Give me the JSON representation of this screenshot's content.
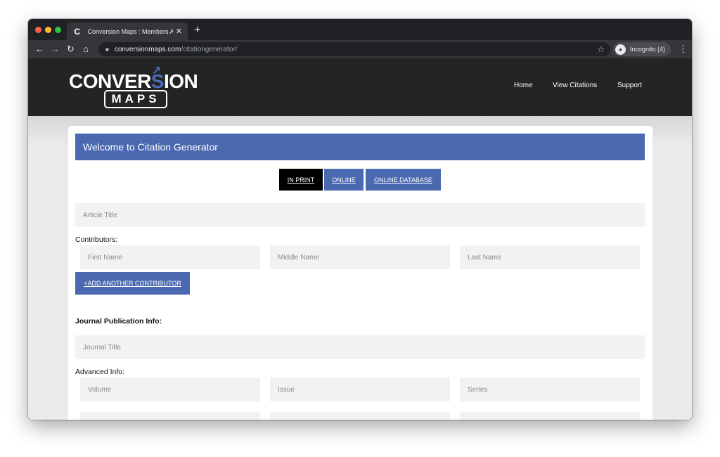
{
  "browser": {
    "tab_title": "Conversion Maps : Members Area",
    "tab_favicon": "C",
    "tab_close": "✕",
    "new_tab": "+",
    "url_host": "conversionmaps.com",
    "url_path": "/citationgenerator/",
    "incognito_label": "Incognito (4)",
    "icons": {
      "back": "back-arrow-icon",
      "forward": "forward-arrow-icon",
      "reload": "reload-icon",
      "home": "home-icon",
      "lock": "lock-icon",
      "star": "star-icon",
      "incognito": "incognito-icon",
      "menu": "kebab-menu-icon"
    }
  },
  "site": {
    "logo": {
      "top_prefix": "CONVER",
      "top_s": "S",
      "top_suffix": "ION",
      "bottom": "MAPS"
    },
    "nav": [
      "Home",
      "View Citations",
      "Support"
    ],
    "brand_color": "#4a69b0",
    "header_color": "#242424"
  },
  "form": {
    "header": "Welcome to Citation Generator",
    "types": [
      {
        "label": "IN PRINT",
        "active": true
      },
      {
        "label": "ONLINE",
        "active": false
      },
      {
        "label": "ONLINE DATABASE",
        "active": false
      }
    ],
    "article_title_placeholder": "Article Title",
    "contributors_label": "Contributors:",
    "first_name_placeholder": "First Name",
    "middle_name_placeholder": "Middle Name",
    "last_name_placeholder": "Last Name",
    "add_contributor_label": "+ADD ANOTHER CONTRIBUTOR",
    "journal_info_label": "Journal Publication Info:",
    "journal_title_placeholder": "Journal Title",
    "advanced_info_label": "Advanced Info:",
    "volume_placeholder": "Volume",
    "issue_placeholder": "Issue",
    "series_placeholder": "Series"
  }
}
